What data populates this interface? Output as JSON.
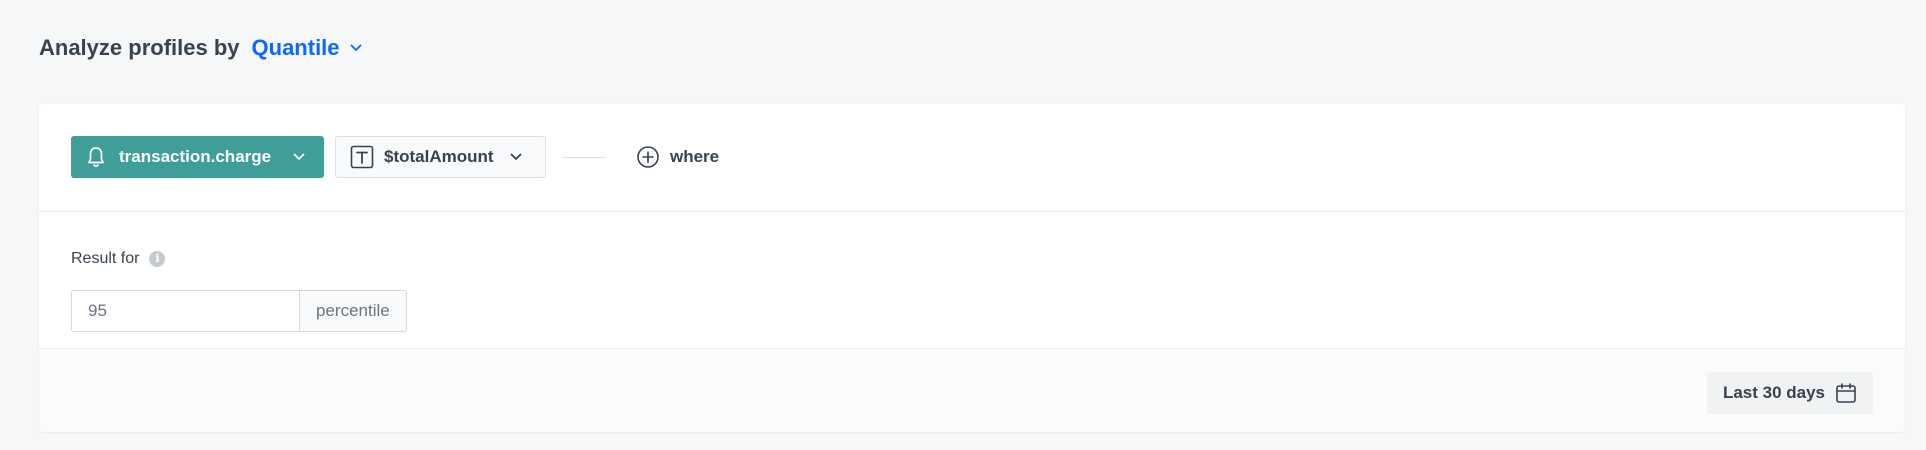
{
  "header": {
    "title": "Analyze profiles by",
    "mode": "Quantile",
    "mode_color": "#0b68ff"
  },
  "query": {
    "event": {
      "label": "transaction.charge",
      "icon": "bell-icon",
      "color": "#3f9f98"
    },
    "parameter": {
      "label": "$totalAmount",
      "icon": "text-type-icon"
    },
    "where": {
      "label": "where",
      "icon": "plus-circle-icon"
    }
  },
  "result": {
    "label": "Result for",
    "info_icon": "info-icon",
    "percentile_value": "95",
    "percentile_suffix": "percentile"
  },
  "footer": {
    "date_range": "Last 30 days",
    "date_icon": "calendar-icon"
  }
}
